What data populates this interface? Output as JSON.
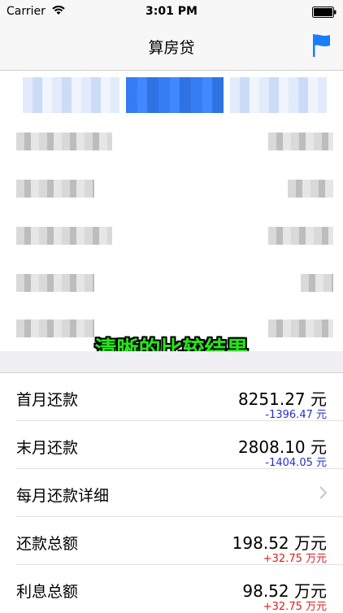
{
  "status_bar": {
    "carrier": "Carrier",
    "time": "3:01 PM"
  },
  "nav": {
    "title": "算房贷",
    "flag_icon": "flag-icon",
    "accent": "#1a7cff"
  },
  "caption": "清晰的比较结果",
  "results": [
    {
      "label": "首月还款",
      "value": "8251.27 元",
      "delta": "-1396.47 元",
      "delta_color": "blue"
    },
    {
      "label": "末月还款",
      "value": "2808.10 元",
      "delta": "-1404.05 元",
      "delta_color": "blue"
    },
    {
      "label": "每月还款详细",
      "value": "",
      "delta": "",
      "chevron": true
    },
    {
      "label": "还款总额",
      "value": "198.52 万元",
      "delta": "+32.75 万元",
      "delta_color": "red"
    },
    {
      "label": "利息总额",
      "value": "98.52 万元",
      "delta": "+32.75 万元",
      "delta_color": "red"
    }
  ]
}
